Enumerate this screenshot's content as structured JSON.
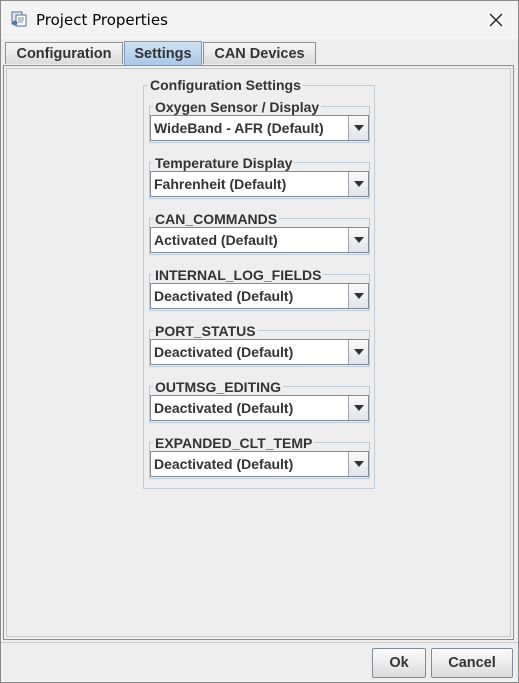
{
  "window": {
    "title": "Project Properties",
    "icon": "app-icon",
    "close_icon": "close-icon"
  },
  "tabs": [
    {
      "label": "Configuration",
      "active": false
    },
    {
      "label": "Settings",
      "active": true
    },
    {
      "label": "CAN Devices",
      "active": false
    }
  ],
  "config": {
    "title": "Configuration Settings",
    "settings": [
      {
        "label": "Oxygen Sensor / Display",
        "value": "WideBand - AFR (Default)"
      },
      {
        "label": "Temperature Display",
        "value": "Fahrenheit (Default)"
      },
      {
        "label": "CAN_COMMANDS",
        "value": "Activated (Default)"
      },
      {
        "label": "INTERNAL_LOG_FIELDS",
        "value": "Deactivated (Default)"
      },
      {
        "label": "PORT_STATUS",
        "value": "Deactivated (Default)"
      },
      {
        "label": "OUTMSG_EDITING",
        "value": "Deactivated (Default)"
      },
      {
        "label": "EXPANDED_CLT_TEMP",
        "value": "Deactivated (Default)"
      }
    ]
  },
  "buttons": {
    "ok": "Ok",
    "cancel": "Cancel"
  },
  "colors": {
    "active_tab": "#b8d3ee",
    "border": "#bccbd8"
  }
}
